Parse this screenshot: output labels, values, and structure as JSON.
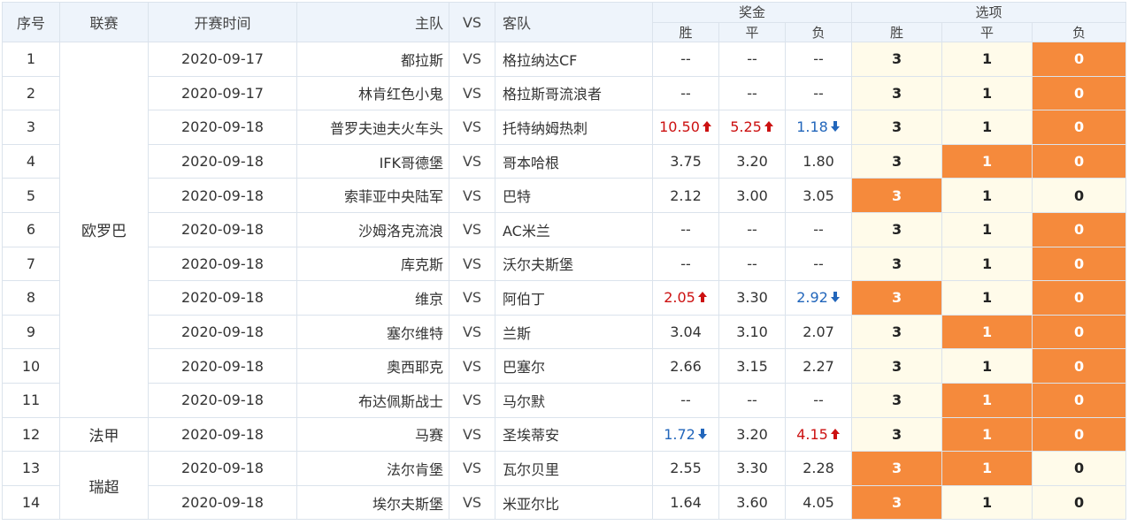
{
  "header": {
    "seq": "序号",
    "league": "联赛",
    "time": "开赛时间",
    "home": "主队",
    "vs": "VS",
    "away": "客队",
    "prize": "奖金",
    "options": "选项",
    "win": "胜",
    "draw": "平",
    "lose": "负"
  },
  "colors": {
    "selected": "#f58a3c",
    "option_bg": "#fffbea",
    "up": "#cc1111",
    "down": "#2266bb",
    "header_bg": "#eef4fb"
  },
  "leagues": [
    {
      "name": "欧罗巴",
      "rows": 11
    },
    {
      "name": "法甲",
      "rows": 1
    },
    {
      "name": "瑞超",
      "rows": 2
    }
  ],
  "rows": [
    {
      "seq": "1",
      "time": "2020-09-17",
      "home": "都拉斯",
      "vs": "VS",
      "away": "格拉纳达CF",
      "odds": [
        {
          "v": "--"
        },
        {
          "v": "--"
        },
        {
          "v": "--"
        }
      ],
      "options": [
        "3",
        "1",
        "0"
      ],
      "selected": [
        2
      ]
    },
    {
      "seq": "2",
      "time": "2020-09-17",
      "home": "林肯红色小鬼",
      "vs": "VS",
      "away": "格拉斯哥流浪者",
      "odds": [
        {
          "v": "--"
        },
        {
          "v": "--"
        },
        {
          "v": "--"
        }
      ],
      "options": [
        "3",
        "1",
        "0"
      ],
      "selected": [
        2
      ]
    },
    {
      "seq": "3",
      "time": "2020-09-18",
      "home": "普罗夫迪夫火车头",
      "vs": "VS",
      "away": "托特纳姆热刺",
      "odds": [
        {
          "v": "10.50",
          "trend": "up"
        },
        {
          "v": "5.25",
          "trend": "up"
        },
        {
          "v": "1.18",
          "trend": "down"
        }
      ],
      "options": [
        "3",
        "1",
        "0"
      ],
      "selected": [
        2
      ]
    },
    {
      "seq": "4",
      "time": "2020-09-18",
      "home": "IFK哥德堡",
      "vs": "VS",
      "away": "哥本哈根",
      "odds": [
        {
          "v": "3.75"
        },
        {
          "v": "3.20"
        },
        {
          "v": "1.80"
        }
      ],
      "options": [
        "3",
        "1",
        "0"
      ],
      "selected": [
        1,
        2
      ]
    },
    {
      "seq": "5",
      "time": "2020-09-18",
      "home": "索菲亚中央陆军",
      "vs": "VS",
      "away": "巴特",
      "odds": [
        {
          "v": "2.12"
        },
        {
          "v": "3.00"
        },
        {
          "v": "3.05"
        }
      ],
      "options": [
        "3",
        "1",
        "0"
      ],
      "selected": [
        0
      ]
    },
    {
      "seq": "6",
      "time": "2020-09-18",
      "home": "沙姆洛克流浪",
      "vs": "VS",
      "away": "AC米兰",
      "odds": [
        {
          "v": "--"
        },
        {
          "v": "--"
        },
        {
          "v": "--"
        }
      ],
      "options": [
        "3",
        "1",
        "0"
      ],
      "selected": [
        2
      ]
    },
    {
      "seq": "7",
      "time": "2020-09-18",
      "home": "库克斯",
      "vs": "VS",
      "away": "沃尔夫斯堡",
      "odds": [
        {
          "v": "--"
        },
        {
          "v": "--"
        },
        {
          "v": "--"
        }
      ],
      "options": [
        "3",
        "1",
        "0"
      ],
      "selected": [
        2
      ]
    },
    {
      "seq": "8",
      "time": "2020-09-18",
      "home": "维京",
      "vs": "VS",
      "away": "阿伯丁",
      "odds": [
        {
          "v": "2.05",
          "trend": "up"
        },
        {
          "v": "3.30"
        },
        {
          "v": "2.92",
          "trend": "down"
        }
      ],
      "options": [
        "3",
        "1",
        "0"
      ],
      "selected": [
        0,
        2
      ]
    },
    {
      "seq": "9",
      "time": "2020-09-18",
      "home": "塞尔维特",
      "vs": "VS",
      "away": "兰斯",
      "odds": [
        {
          "v": "3.04"
        },
        {
          "v": "3.10"
        },
        {
          "v": "2.07"
        }
      ],
      "options": [
        "3",
        "1",
        "0"
      ],
      "selected": [
        1,
        2
      ]
    },
    {
      "seq": "10",
      "time": "2020-09-18",
      "home": "奥西耶克",
      "vs": "VS",
      "away": "巴塞尔",
      "odds": [
        {
          "v": "2.66"
        },
        {
          "v": "3.15"
        },
        {
          "v": "2.27"
        }
      ],
      "options": [
        "3",
        "1",
        "0"
      ],
      "selected": [
        2
      ]
    },
    {
      "seq": "11",
      "time": "2020-09-18",
      "home": "布达佩斯战士",
      "vs": "VS",
      "away": "马尔默",
      "odds": [
        {
          "v": "--"
        },
        {
          "v": "--"
        },
        {
          "v": "--"
        }
      ],
      "options": [
        "3",
        "1",
        "0"
      ],
      "selected": [
        1,
        2
      ]
    },
    {
      "seq": "12",
      "time": "2020-09-18",
      "home": "马赛",
      "vs": "VS",
      "away": "圣埃蒂安",
      "odds": [
        {
          "v": "1.72",
          "trend": "down"
        },
        {
          "v": "3.20"
        },
        {
          "v": "4.15",
          "trend": "up"
        }
      ],
      "options": [
        "3",
        "1",
        "0"
      ],
      "selected": [
        1,
        2
      ]
    },
    {
      "seq": "13",
      "time": "2020-09-18",
      "home": "法尔肯堡",
      "vs": "VS",
      "away": "瓦尔贝里",
      "odds": [
        {
          "v": "2.55"
        },
        {
          "v": "3.30"
        },
        {
          "v": "2.28"
        }
      ],
      "options": [
        "3",
        "1",
        "0"
      ],
      "selected": [
        0,
        1
      ]
    },
    {
      "seq": "14",
      "time": "2020-09-18",
      "home": "埃尔夫斯堡",
      "vs": "VS",
      "away": "米亚尔比",
      "odds": [
        {
          "v": "1.64"
        },
        {
          "v": "3.60"
        },
        {
          "v": "4.05"
        }
      ],
      "options": [
        "3",
        "1",
        "0"
      ],
      "selected": [
        0
      ]
    }
  ]
}
